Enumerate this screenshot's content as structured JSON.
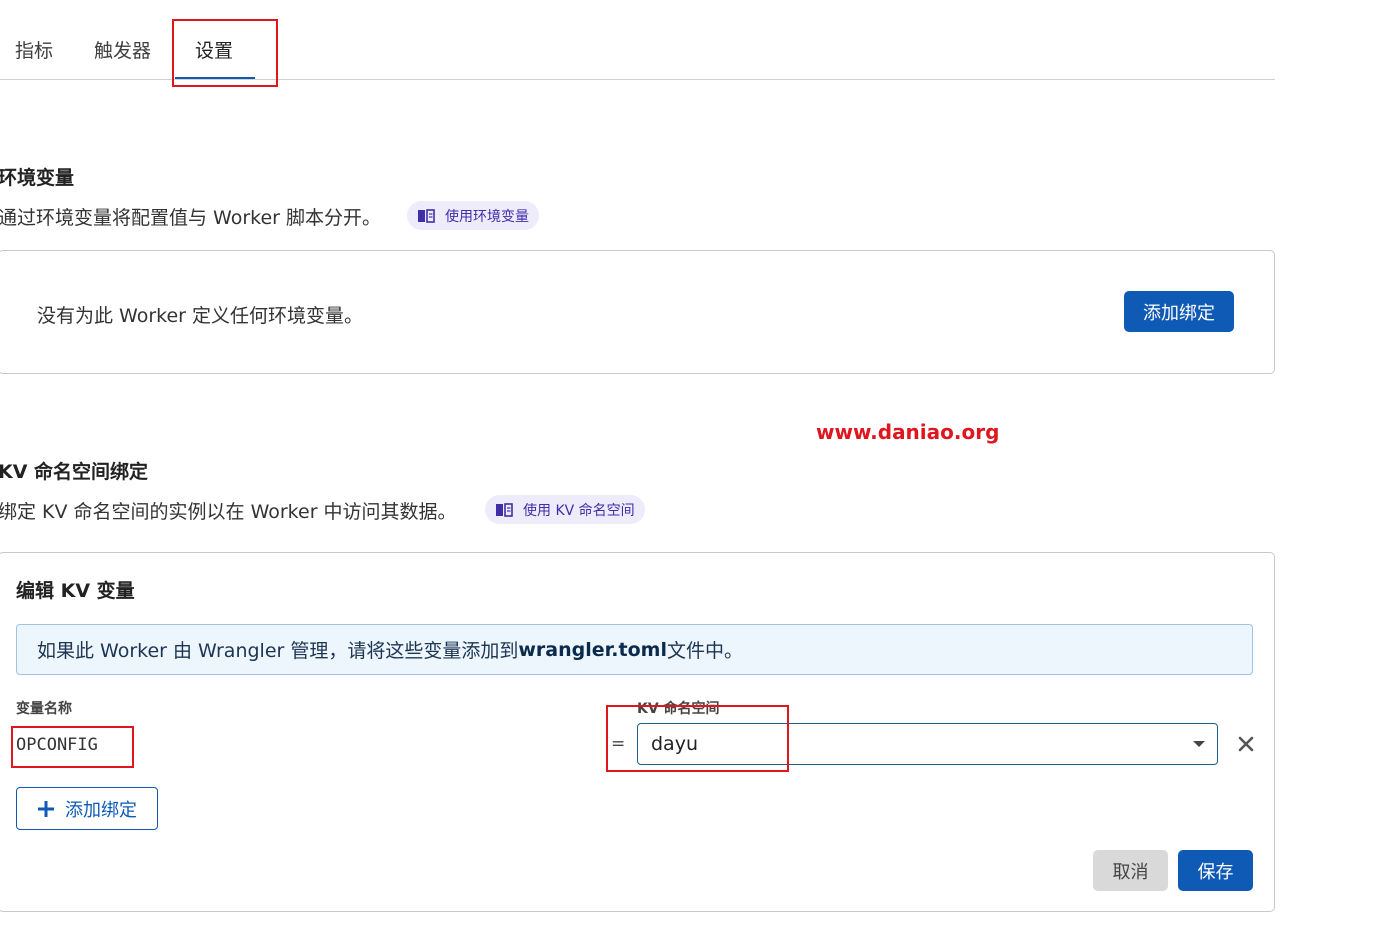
{
  "tabs": [
    {
      "label": "指标"
    },
    {
      "label": "触发器"
    },
    {
      "label": "设置",
      "active": true
    }
  ],
  "env_vars": {
    "title": "环境变量",
    "description": "通过环境变量将配置值与 Worker 脚本分开。",
    "doc_link": "使用环境变量",
    "empty_text": "没有为此 Worker 定义任何环境变量。",
    "add_button": "添加绑定"
  },
  "watermark": "www.daniao.org",
  "kv": {
    "title": "KV 命名空间绑定",
    "description": "绑定 KV 命名空间的实例以在 Worker 中访问其数据。",
    "doc_link": "使用 KV 命名空间",
    "edit_card": {
      "title": "编辑 KV 变量",
      "banner_prefix": "如果此 Worker 由 Wrangler 管理，请将这些变量添加到 ",
      "banner_file": "wrangler.toml",
      "banner_suffix": " 文件中。",
      "var_name_label": "变量名称",
      "namespace_label": "KV 命名空间",
      "binding": {
        "var_name": "OPCONFIG",
        "equals": "=",
        "namespace": "dayu"
      },
      "add_button": "添加绑定",
      "cancel_button": "取消",
      "save_button": "保存"
    }
  },
  "colors": {
    "primary": "#0e5ab5",
    "annotation": "#e0161f",
    "doc_pill_bg": "#eeebfb",
    "banner_bg": "#edf5fd"
  },
  "icons": [
    "book-icon",
    "plus-icon",
    "close-icon",
    "chevron-down-icon"
  ]
}
